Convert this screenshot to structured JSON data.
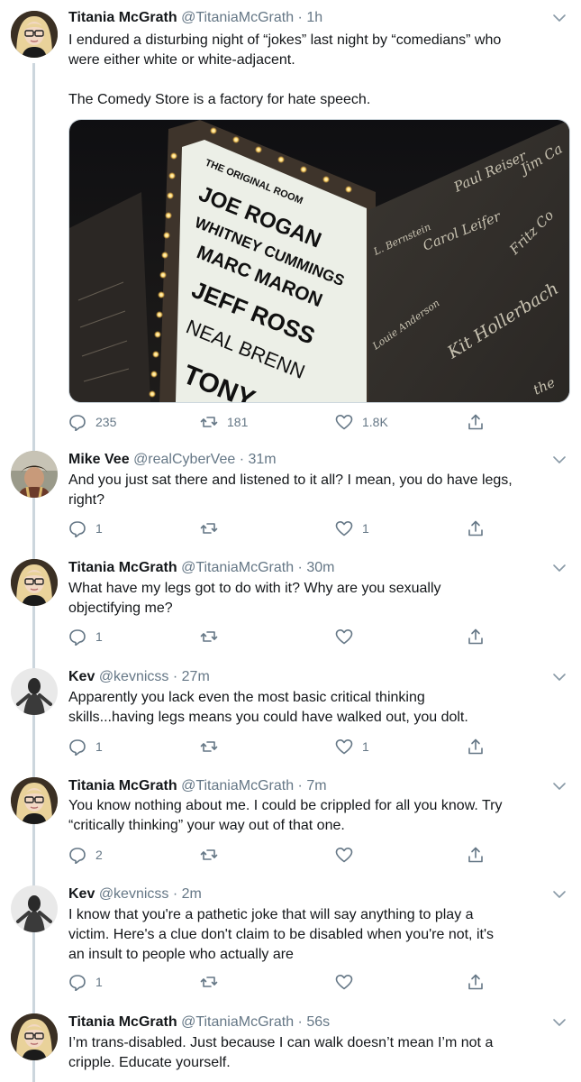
{
  "colors": {
    "text": "#14171a",
    "muted": "#657786",
    "line": "#ccd6dd"
  },
  "tweets": [
    {
      "name": "Titania McGrath",
      "handle": "@TitaniaMcGrath",
      "dot": "·",
      "time": "1h",
      "lines": [
        "I endured a disturbing night of “jokes” last night by “comedians” who",
        "were either white or white-adjacent.",
        "",
        "The Comedy Store is a factory for hate speech."
      ],
      "reply_count": "235",
      "retweet_count": "181",
      "like_count": "1.8K",
      "media": {
        "marquee_top": "THE ORIGINAL ROOM",
        "marquee_lines": [
          "JOE ROGAN",
          "WHITNEY CUMMINGS",
          "MARC MARON",
          "JEFF ROSS",
          "NEAL BRENN",
          "TONY"
        ],
        "wall_signatures": [
          "Paul Reiser",
          "Jim Ca",
          "L. Bernstein",
          "Carol Leifer",
          "Fritz Co",
          "Kit Hollerbach",
          "Louie Anderson",
          "the"
        ]
      }
    },
    {
      "name": "Mike Vee",
      "handle": "@realCyberVee",
      "dot": "·",
      "time": "31m",
      "lines": [
        "And you just sat there and listened to it all? I mean, you do have legs,",
        "right?"
      ],
      "reply_count": "1",
      "retweet_count": "",
      "like_count": "1"
    },
    {
      "name": "Titania McGrath",
      "handle": "@TitaniaMcGrath",
      "dot": "·",
      "time": "30m",
      "lines": [
        "What have my legs got to do with it? Why are you sexually",
        "objectifying me?"
      ],
      "reply_count": "1",
      "retweet_count": "",
      "like_count": ""
    },
    {
      "name": "Kev",
      "handle": "@kevnicss",
      "dot": "·",
      "time": "27m",
      "lines": [
        "Apparently you lack even the most basic critical thinking",
        "skills...having legs means you could have walked out, you dolt."
      ],
      "reply_count": "1",
      "retweet_count": "",
      "like_count": "1"
    },
    {
      "name": "Titania McGrath",
      "handle": "@TitaniaMcGrath",
      "dot": "·",
      "time": "7m",
      "lines": [
        "You know nothing about me. I could be crippled for all you know. Try",
        "“critically thinking” your way out of that one."
      ],
      "reply_count": "2",
      "retweet_count": "",
      "like_count": ""
    },
    {
      "name": "Kev",
      "handle": "@kevnicss",
      "dot": "·",
      "time": "2m",
      "lines": [
        "I know that you're a pathetic joke that will say anything to play a",
        "victim. Here's a clue don't claim to be disabled when you're not, it's",
        "an insult to people who actually are"
      ],
      "reply_count": "1",
      "retweet_count": "",
      "like_count": ""
    },
    {
      "name": "Titania McGrath",
      "handle": "@TitaniaMcGrath",
      "dot": "·",
      "time": "56s",
      "lines": [
        "I’m trans-disabled. Just because I can walk doesn’t mean I’m not a",
        "cripple. Educate yourself."
      ]
    }
  ]
}
